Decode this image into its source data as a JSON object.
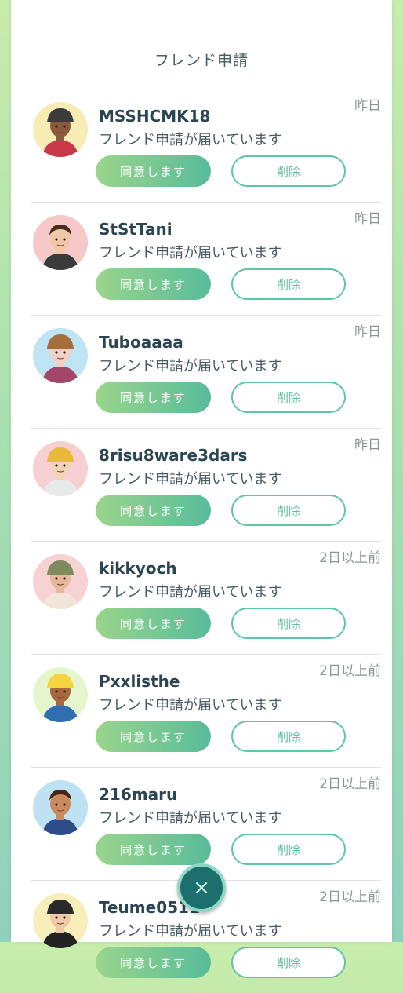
{
  "header": {
    "title": "フレンド申請"
  },
  "requests": [
    {
      "name": "MSSHCMK18",
      "message": "フレンド申請が届いています",
      "time": "昨日",
      "accept_label": "同意します",
      "delete_label": "削除",
      "avatar_bg": "#f7ecb4"
    },
    {
      "name": "StStTani",
      "message": "フレンド申請が届いています",
      "time": "昨日",
      "accept_label": "同意します",
      "delete_label": "削除",
      "avatar_bg": "#f6c9c8"
    },
    {
      "name": "Tuboaaaa",
      "message": "フレンド申請が届いています",
      "time": "昨日",
      "accept_label": "同意します",
      "delete_label": "削除",
      "avatar_bg": "#bfe4f3"
    },
    {
      "name": "8risu8ware3dars",
      "message": "フレンド申請が届いています",
      "time": "昨日",
      "accept_label": "同意します",
      "delete_label": "削除",
      "avatar_bg": "#f6cfd2"
    },
    {
      "name": "kikkyoch",
      "message": "フレンド申請が届いています",
      "time": "2日以上前",
      "accept_label": "同意します",
      "delete_label": "削除",
      "avatar_bg": "#f6d2d3"
    },
    {
      "name": "Pxxlisthe",
      "message": "フレンド申請が届いています",
      "time": "2日以上前",
      "accept_label": "同意します",
      "delete_label": "削除",
      "avatar_bg": "#e5f6cf"
    },
    {
      "name": "216maru",
      "message": "フレンド申請が届いています",
      "time": "2日以上前",
      "accept_label": "同意します",
      "delete_label": "削除",
      "avatar_bg": "#bfe1f4"
    },
    {
      "name": "Teume0511",
      "message": "フレンド申請が届いています",
      "time": "2日以上前",
      "accept_label": "同意します",
      "delete_label": "削除",
      "avatar_bg": "#f7eebb"
    }
  ],
  "colors": {
    "accent_start": "#9ad58c",
    "accent_end": "#58bc9a",
    "close_button": "#1d6f6e"
  },
  "close_button": {
    "icon": "close-icon",
    "glyph": "×"
  }
}
